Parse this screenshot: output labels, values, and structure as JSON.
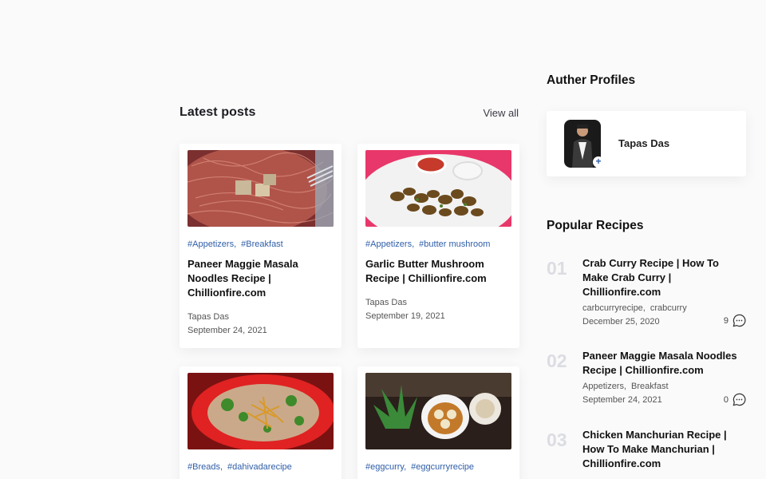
{
  "latest": {
    "title": "Latest posts",
    "view_all": "View all",
    "posts": [
      {
        "tags": [
          "#Appetizers,",
          "#Breakfast"
        ],
        "title": "Paneer Maggie Masala Noodles Recipe | Chillionfire.com",
        "author": "Tapas Das",
        "date": "September 24, 2021",
        "image": "paneer-maggie-noodles-photo"
      },
      {
        "tags": [
          "#Appetizers,",
          "#butter mushroom"
        ],
        "title": "Garlic Butter Mushroom Recipe | Chillionfire.com",
        "author": "Tapas Das",
        "date": "September 19, 2021",
        "image": "garlic-butter-mushroom-photo"
      },
      {
        "tags": [
          "#Breads,",
          "#dahivadarecipe"
        ],
        "title": "",
        "author": "",
        "date": "",
        "image": "dahi-vada-photo"
      },
      {
        "tags": [
          "#eggcurry,",
          "#eggcurryrecipe"
        ],
        "title": "",
        "author": "",
        "date": "",
        "image": "egg-curry-photo"
      }
    ]
  },
  "authors": {
    "heading": "Auther Profiles",
    "profile": {
      "name": "Tapas Das",
      "plus": "+"
    }
  },
  "popular": {
    "heading": "Popular Recipes",
    "items": [
      {
        "num": "01",
        "title": "Crab Curry Recipe | How To Make Crab Curry | Chillionfire.com",
        "tags": [
          "carbcurryrecipe,",
          "crabcurry"
        ],
        "date": "December 25, 2020",
        "comments": "9"
      },
      {
        "num": "02",
        "title": "Paneer Maggie Masala Noodles Recipe | Chillionfire.com",
        "tags": [
          "Appetizers,",
          "Breakfast"
        ],
        "date": "September 24, 2021",
        "comments": "0"
      },
      {
        "num": "03",
        "title": "Chicken Manchurian Recipe | How To Make Manchurian | Chillionfire.com",
        "tags": [],
        "date": "",
        "comments": ""
      }
    ]
  },
  "colors": {
    "tag": "#2f5ea8",
    "card_bg": "#ffffff",
    "page_bg": "#fafafb",
    "number": "#dcdde2"
  },
  "icons": {
    "comment": "comment-bubble-icon"
  }
}
